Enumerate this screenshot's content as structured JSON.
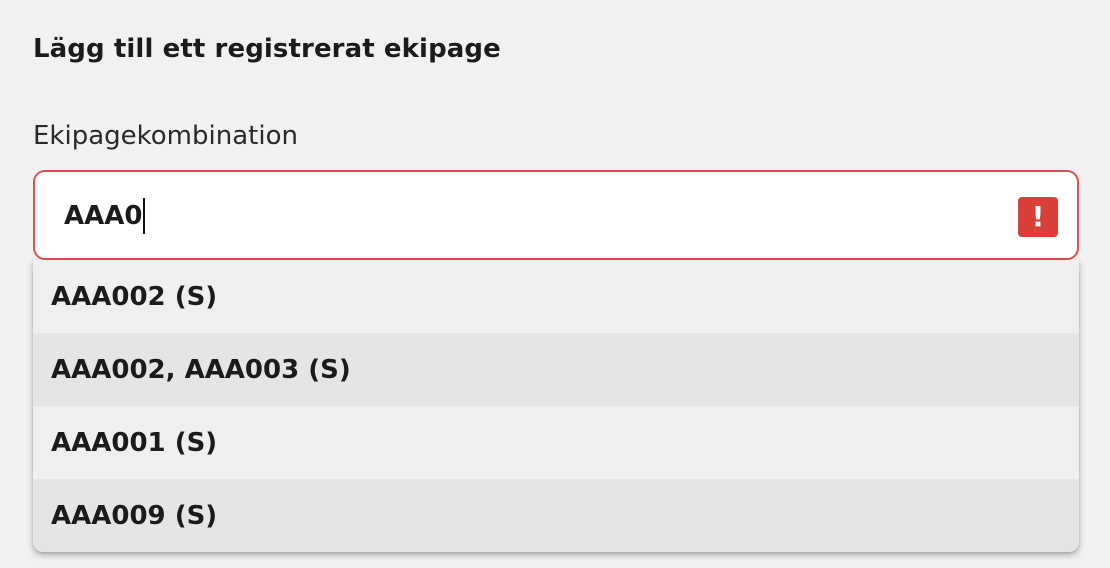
{
  "form": {
    "heading": "Lägg till ett registrerat ekipage",
    "field_label": "Ekipagekombination",
    "input_value": "AAA0",
    "error_icon_glyph": "!",
    "error_icon": "exclamation-icon",
    "error_color": "#d9403a"
  },
  "dropdown": {
    "options": [
      "AAA002 (S)",
      "AAA002, AAA003 (S)",
      "AAA001 (S)",
      "AAA009 (S)"
    ]
  }
}
